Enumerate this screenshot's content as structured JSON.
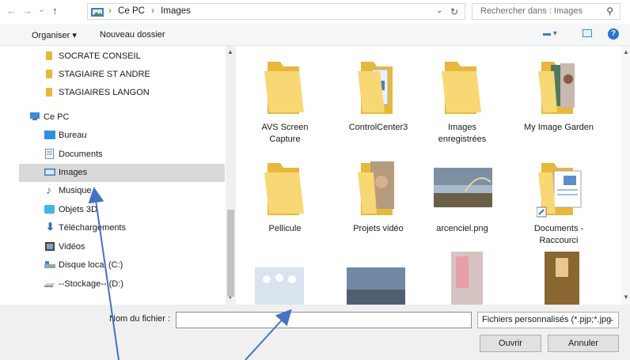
{
  "addressbar": {
    "back": "←",
    "forward": "→",
    "recent": "⌄",
    "up": "↑",
    "path": [
      "Ce PC",
      "Images"
    ],
    "separator": "›",
    "dropdown": "⌄",
    "refresh": "↻",
    "search_placeholder": "Rechercher dans : Images",
    "search_glyph": "⚲"
  },
  "toolbar": {
    "organiser": "Organiser ▾",
    "new_folder": "Nouveau dossier",
    "views": "▬ ▾",
    "help": "?"
  },
  "sidebar": {
    "items": [
      {
        "label": "SOCRATE CONSEIL"
      },
      {
        "label": "STAGIAIRE ST ANDRE"
      },
      {
        "label": "STAGIAIRES LANGON"
      },
      {
        "label": "Ce PC"
      },
      {
        "label": "Bureau"
      },
      {
        "label": "Documents"
      },
      {
        "label": "Images"
      },
      {
        "label": "Musique"
      },
      {
        "label": "Objets 3D"
      },
      {
        "label": "Téléchargements"
      },
      {
        "label": "Vidéos"
      },
      {
        "label": "Disque local (C:)"
      },
      {
        "label": "--Stockage-- (D:)"
      }
    ],
    "scroll_up": "▲",
    "scroll_down": "▼"
  },
  "files": [
    {
      "name": "AVS Screen Capture",
      "lines": [
        "AVS Screen",
        "Capture"
      ]
    },
    {
      "name": "ControlCenter3",
      "lines": [
        "ControlCenter3",
        ""
      ]
    },
    {
      "name": "Images enregistrées",
      "lines": [
        "Images",
        "enregistrées"
      ]
    },
    {
      "name": "My Image Garden",
      "lines": [
        "My Image Garden",
        ""
      ]
    },
    {
      "name": "Pellicule",
      "lines": [
        "Pellicule",
        ""
      ]
    },
    {
      "name": "Projets vidéo",
      "lines": [
        "Projets vidéo",
        ""
      ]
    },
    {
      "name": "arcenciel.png",
      "lines": [
        "arcenciel.png",
        ""
      ]
    },
    {
      "name": "Documents - Raccourci",
      "lines": [
        "Documents -",
        "Raccourci"
      ]
    }
  ],
  "footer": {
    "filename_label": "Nom du fichier :",
    "filename_value": "",
    "filename_dd": "⌄",
    "filter": "Fichiers personnalisés (*.pjp;*.jpg",
    "filter_dd": "⌄",
    "open": "Ouvrir",
    "cancel": "Annuler"
  },
  "colors": {
    "folder": "#f8d775",
    "folder_dark": "#e8b83c",
    "selection": "#d9d9d9",
    "accent": "#2b75d3",
    "annotation_arrow": "#4472c4"
  }
}
